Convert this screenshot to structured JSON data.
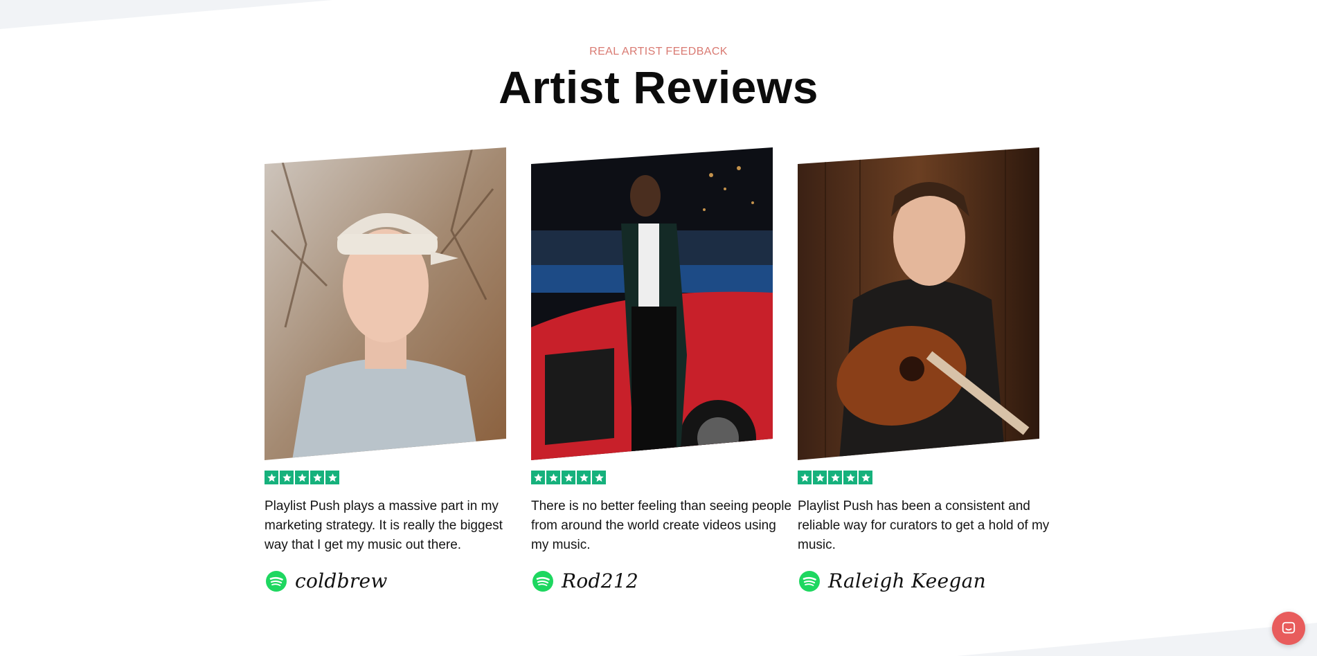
{
  "section": {
    "eyebrow": "REAL ARTIST FEEDBACK",
    "title": "Artist Reviews"
  },
  "reviews": [
    {
      "rating": 5,
      "quote": "Playlist Push plays a massive part in my marketing strategy. It is really the biggest way that I get my music out there.",
      "artist": "coldbrew",
      "platform_icon": "spotify-icon"
    },
    {
      "rating": 5,
      "quote": "There is no better feeling than seeing people from around the world create videos using my music.",
      "artist": "Rod212",
      "platform_icon": "spotify-icon"
    },
    {
      "rating": 5,
      "quote": "Playlist Push has been a consistent and reliable way for curators to get a hold of my music.",
      "artist": "Raleigh Keegan",
      "platform_icon": "spotify-icon"
    }
  ],
  "colors": {
    "eyebrow": "#d97a72",
    "star_bg": "#16b17c",
    "spotify": "#1ed760",
    "chat": "#e85c5c"
  },
  "chat_widget": {
    "icon": "chat-icon"
  }
}
